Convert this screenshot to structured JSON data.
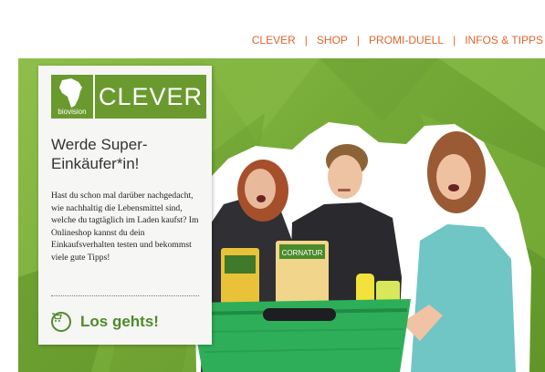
{
  "logo": {
    "subtitle": "biovision",
    "brand": "CLEVER"
  },
  "nav": {
    "items": [
      {
        "label": "CLEVER"
      },
      {
        "label": "SHOP"
      },
      {
        "label": "PROMI-DUELL"
      },
      {
        "label": "INFOS & TIPPS"
      }
    ],
    "separator": "|"
  },
  "card": {
    "title_line1": "Werde Super-",
    "title_line2": "Einkäufer*in!",
    "body": "Hast du schon mal darüber nachgedacht, wie nachhaltig die Lebensmittel sind, welche du tagtäglich im Laden kaufst? Im Onlineshop kannst du dein Einkaufsverhalten testen und bekommst viele gute Tipps!",
    "cta_label": "Los gehts!",
    "cta_icon": "shopping-cart-icon"
  },
  "hero": {
    "image": "three-teenagers-with-shopping-basket",
    "product_label": "CORNATUR"
  },
  "colors": {
    "accent_orange": "#e0662f",
    "brand_green": "#6a9a2e",
    "background_green": "#77ab38",
    "basket_green": "#2fae5a"
  }
}
